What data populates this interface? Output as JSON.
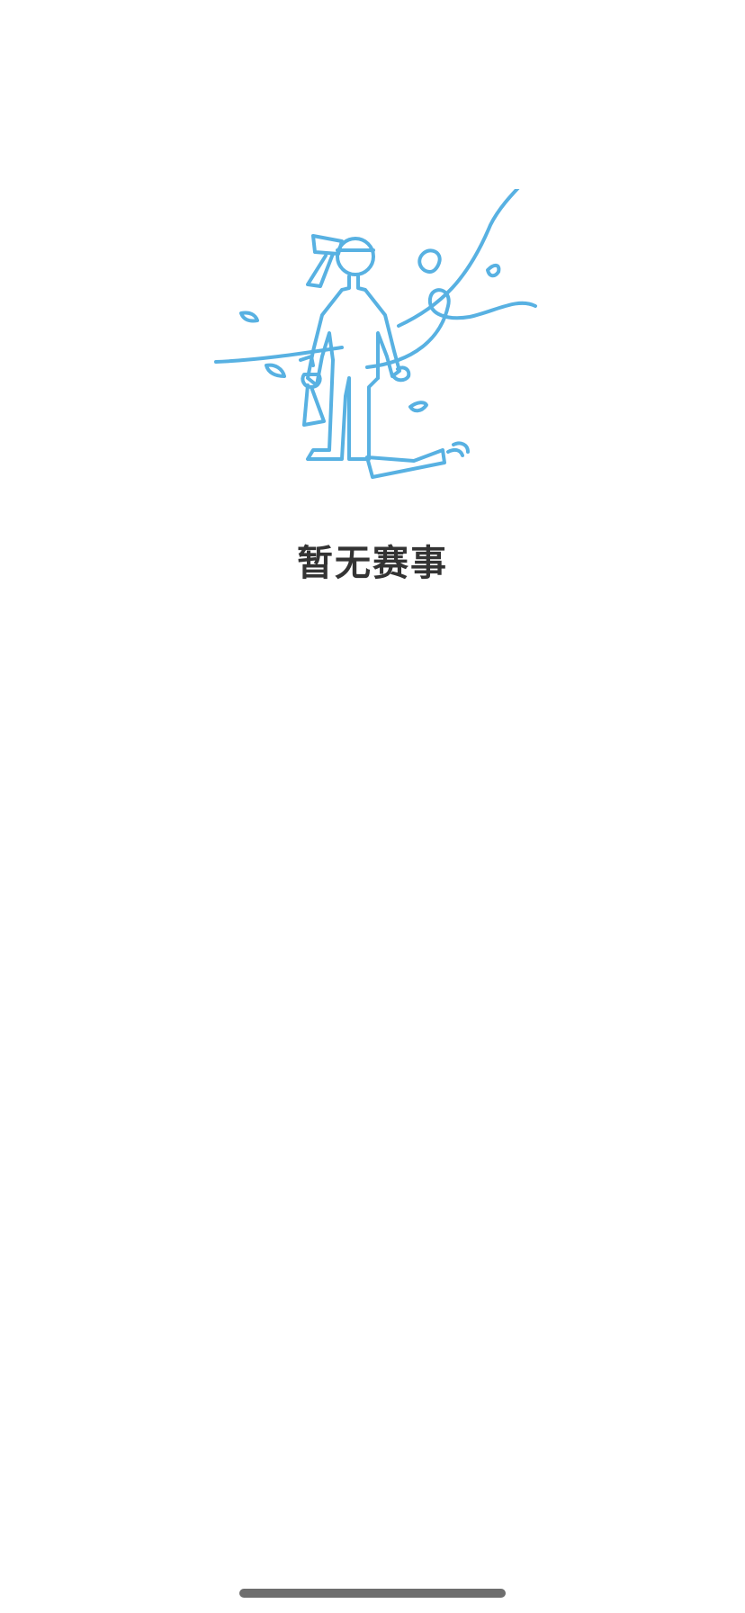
{
  "empty_state": {
    "illustration_icon": "lone-figure-with-ribbons-icon",
    "illustration_color": "#58b1e2",
    "title": "暂无赛事"
  },
  "system": {
    "home_indicator_color": "#6e6e6e"
  }
}
